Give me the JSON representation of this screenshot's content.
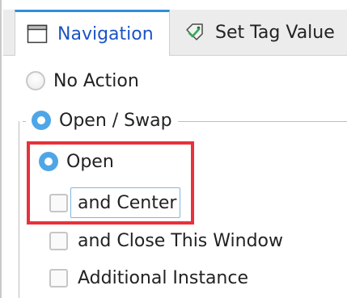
{
  "tabs": [
    {
      "label": "Navigation",
      "icon": "window-icon",
      "active": true
    },
    {
      "label": "Set Tag Value",
      "icon": "tag-check-icon",
      "active": false
    }
  ],
  "options": {
    "no_action": {
      "label": "No Action",
      "selected": false
    },
    "open_swap": {
      "label": "Open / Swap",
      "selected": true
    },
    "open": {
      "label": "Open",
      "selected": true
    },
    "and_center": {
      "label": "and Center",
      "checked": false
    },
    "and_close": {
      "label": "and Close This Window",
      "checked": false
    },
    "additional_instance": {
      "label": "Additional Instance",
      "checked": false
    }
  },
  "colors": {
    "accent": "#2f8fd8",
    "highlight": "#e8313b",
    "radio_selected": "#4fa6e6"
  }
}
